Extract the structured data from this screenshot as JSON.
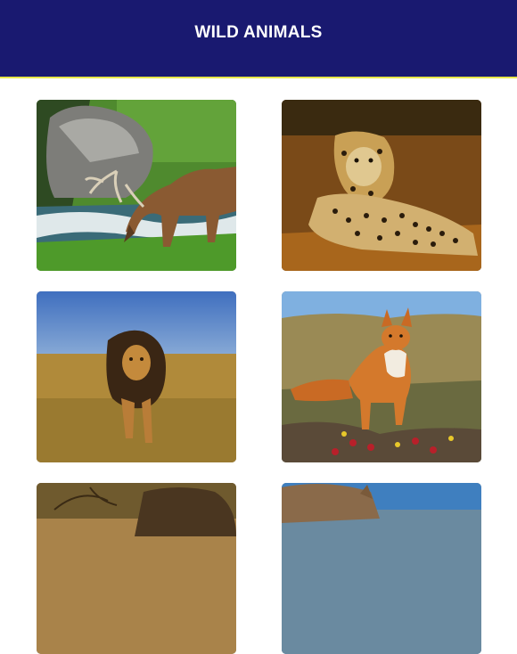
{
  "header": {
    "title": "WILD ANIMALS",
    "background": "#191970",
    "accent": "#e8e84a"
  },
  "gallery": [
    {
      "animal": "elk"
    },
    {
      "animal": "leopard"
    },
    {
      "animal": "lion"
    },
    {
      "animal": "fox"
    },
    {
      "animal": "bison"
    },
    {
      "animal": "rhino"
    }
  ]
}
